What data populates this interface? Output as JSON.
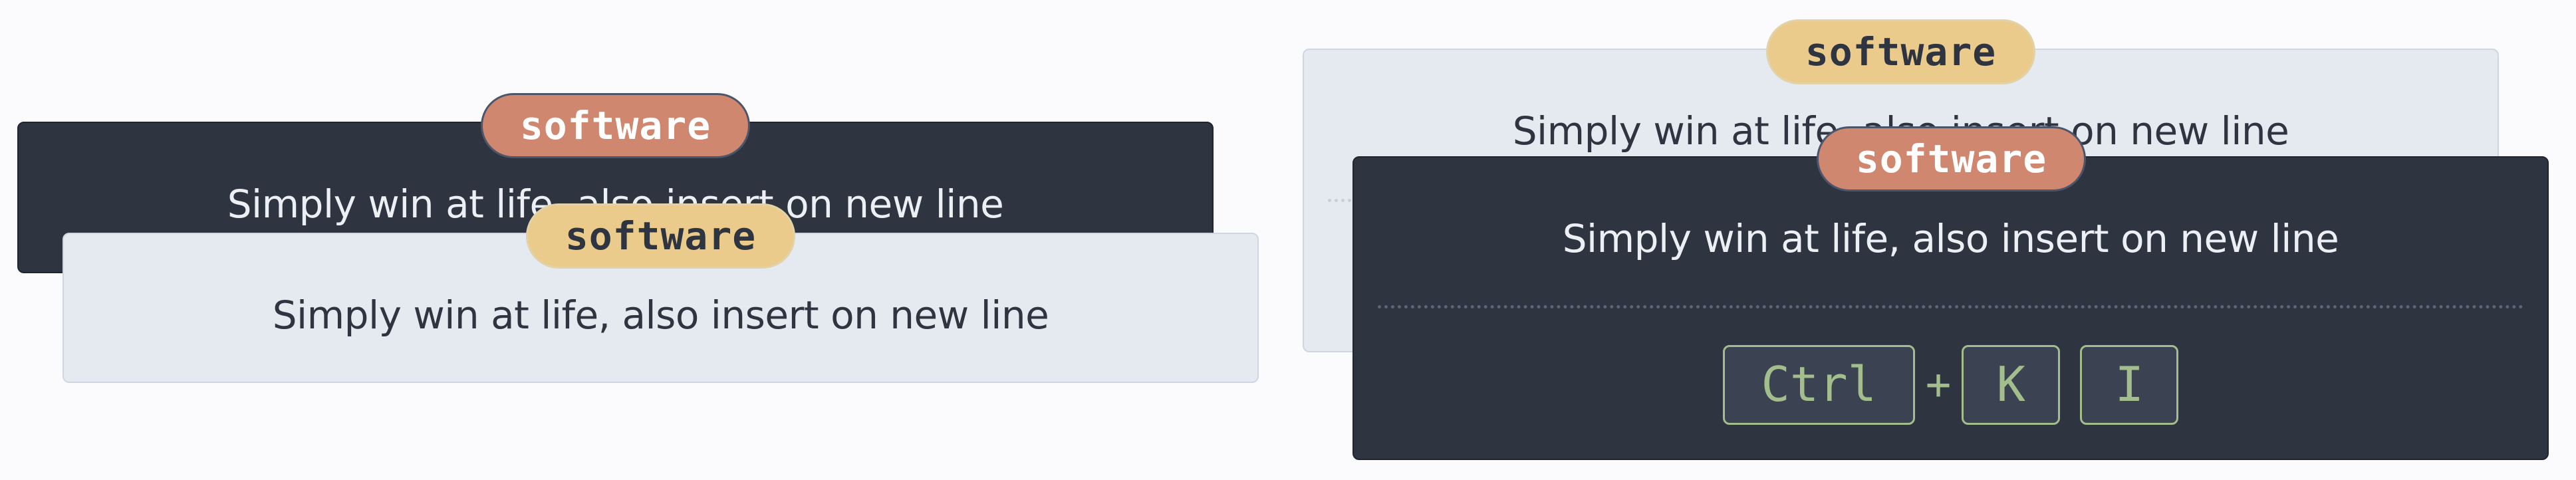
{
  "variant_a": {
    "back_card": {
      "tag": "software",
      "text": "Simply win at life, also insert on new line"
    },
    "front_card": {
      "tag": "software",
      "text": "Simply win at life, also insert on new line"
    }
  },
  "variant_b": {
    "back_card": {
      "tag": "software",
      "text": "Simply win at life, also insert on new line"
    },
    "front_card": {
      "tag": "software",
      "text": "Simply win at life, also insert on new line",
      "shortcut": {
        "key1": "Ctrl",
        "separator": "+",
        "key2": "K",
        "key3": "I"
      }
    }
  },
  "colors": {
    "dark_card": "#2e3440",
    "light_card": "#e5e9f0",
    "badge_red": "#d08770",
    "badge_yellow": "#ebcb8b",
    "key_accent": "#a3be8c"
  }
}
